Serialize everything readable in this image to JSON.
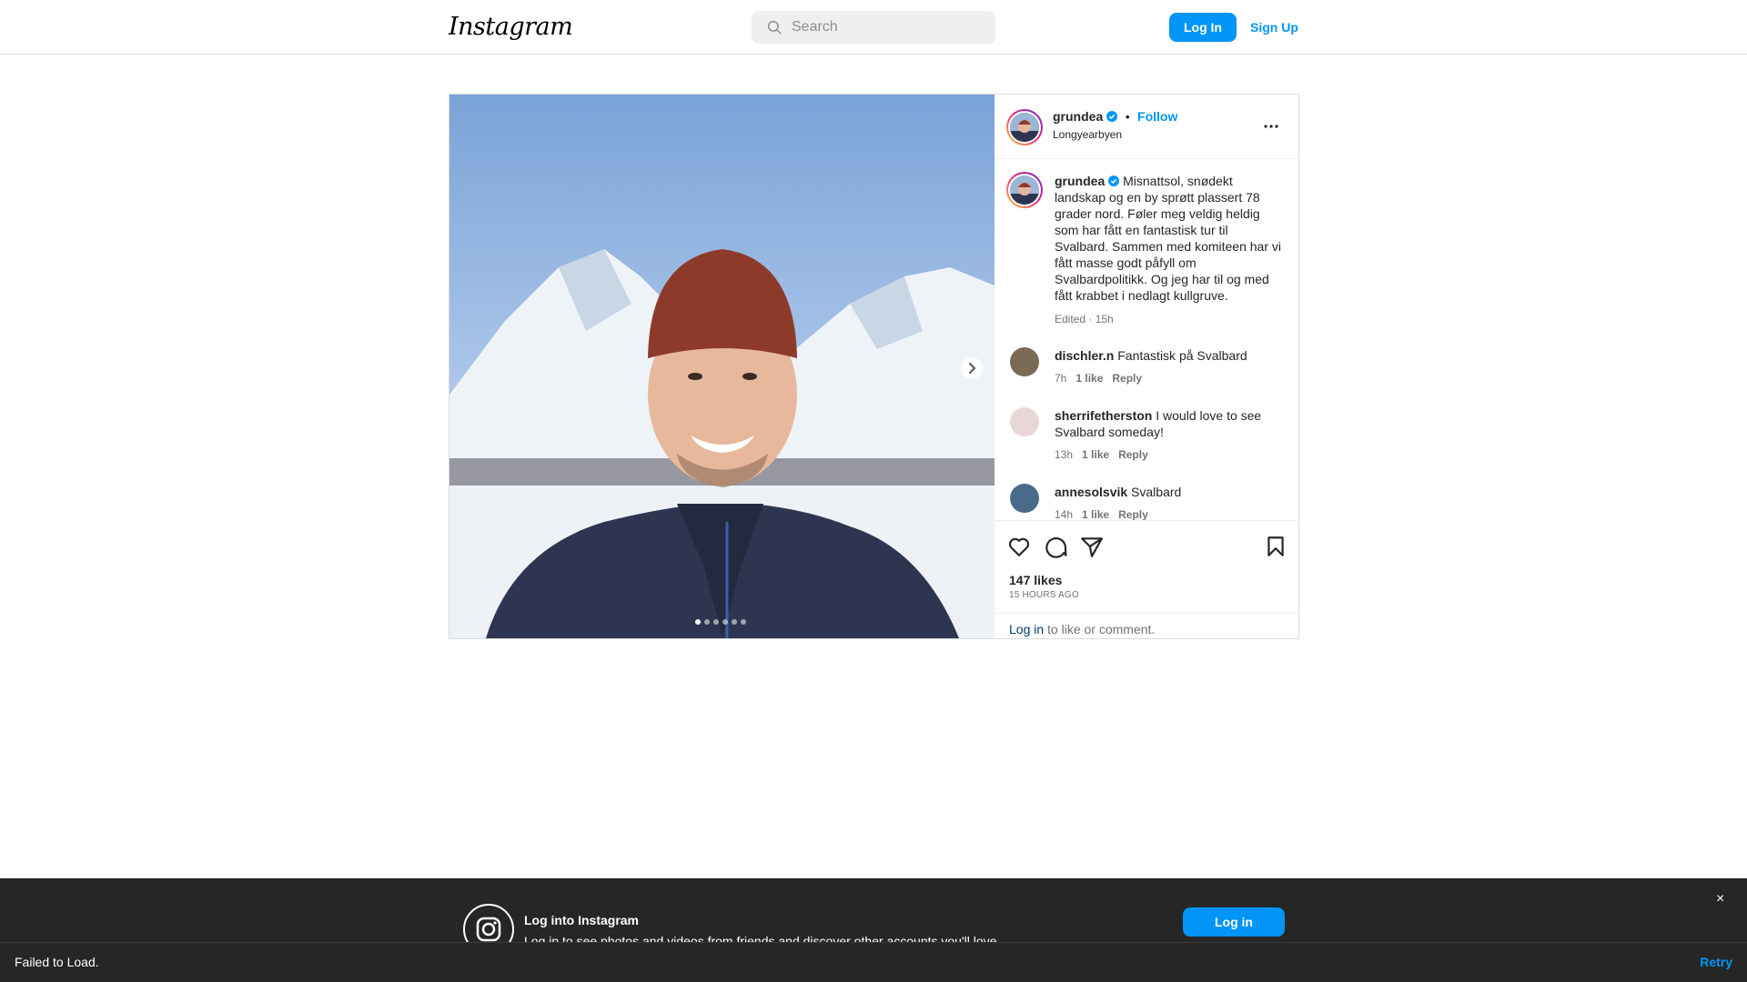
{
  "header": {
    "logo_text": "Instagram",
    "search_placeholder": "Search",
    "login_label": "Log In",
    "signup_label": "Sign Up"
  },
  "post": {
    "author": "grundea",
    "follow_separator": "•",
    "follow_label": "Follow",
    "location": "Longyearbyen",
    "caption": "Misnattsol, snødekt landskap og en by sprøtt plassert 78 grader nord. Føler meg veldig heldig som har fått en fantastisk tur til Svalbard. Sammen med komiteen har vi fått masse godt påfyll om Svalbardpolitikk. Og jeg har til og med fått krabbet i nedlagt kullgruve.",
    "caption_meta": "Edited · 15h",
    "carousel_count": 6,
    "carousel_index": 0,
    "comments": [
      {
        "user": "dischler.n",
        "text": "Fantastisk på Svalbard ",
        "time": "7h",
        "likes": "1 like",
        "reply": "Reply",
        "avatar_color": "#7a6a55"
      },
      {
        "user": "sherrifetherston",
        "text": "I would love to see Svalbard someday!",
        "time": "13h",
        "likes": "1 like",
        "reply": "Reply",
        "avatar_color": "#e8d7d7"
      },
      {
        "user": "annesolsvik",
        "text": "Svalbard ",
        "time": "14h",
        "likes": "1 like",
        "reply": "Reply",
        "avatar_color": "#4a6a8a"
      }
    ],
    "likes": "147 likes",
    "time_ago": "15 HOURS AGO",
    "login_link": "Log in",
    "login_suffix": " to like or comment."
  },
  "banner": {
    "title": "Log into Instagram",
    "subtitle": "Log in to see photos and videos from friends and discover other accounts you'll love.",
    "login_label": "Log in",
    "close_glyph": "×"
  },
  "toast": {
    "message": "Failed to Load.",
    "retry_label": "Retry"
  },
  "colors": {
    "accent": "#0095f6",
    "border": "#dbdbdb",
    "banner_bg": "#262626"
  },
  "icons": [
    "search-icon",
    "verified-icon",
    "more-icon",
    "chevron-right-icon",
    "heart-icon",
    "comment-icon",
    "share-icon",
    "bookmark-icon",
    "instagram-icon",
    "close-icon"
  ]
}
